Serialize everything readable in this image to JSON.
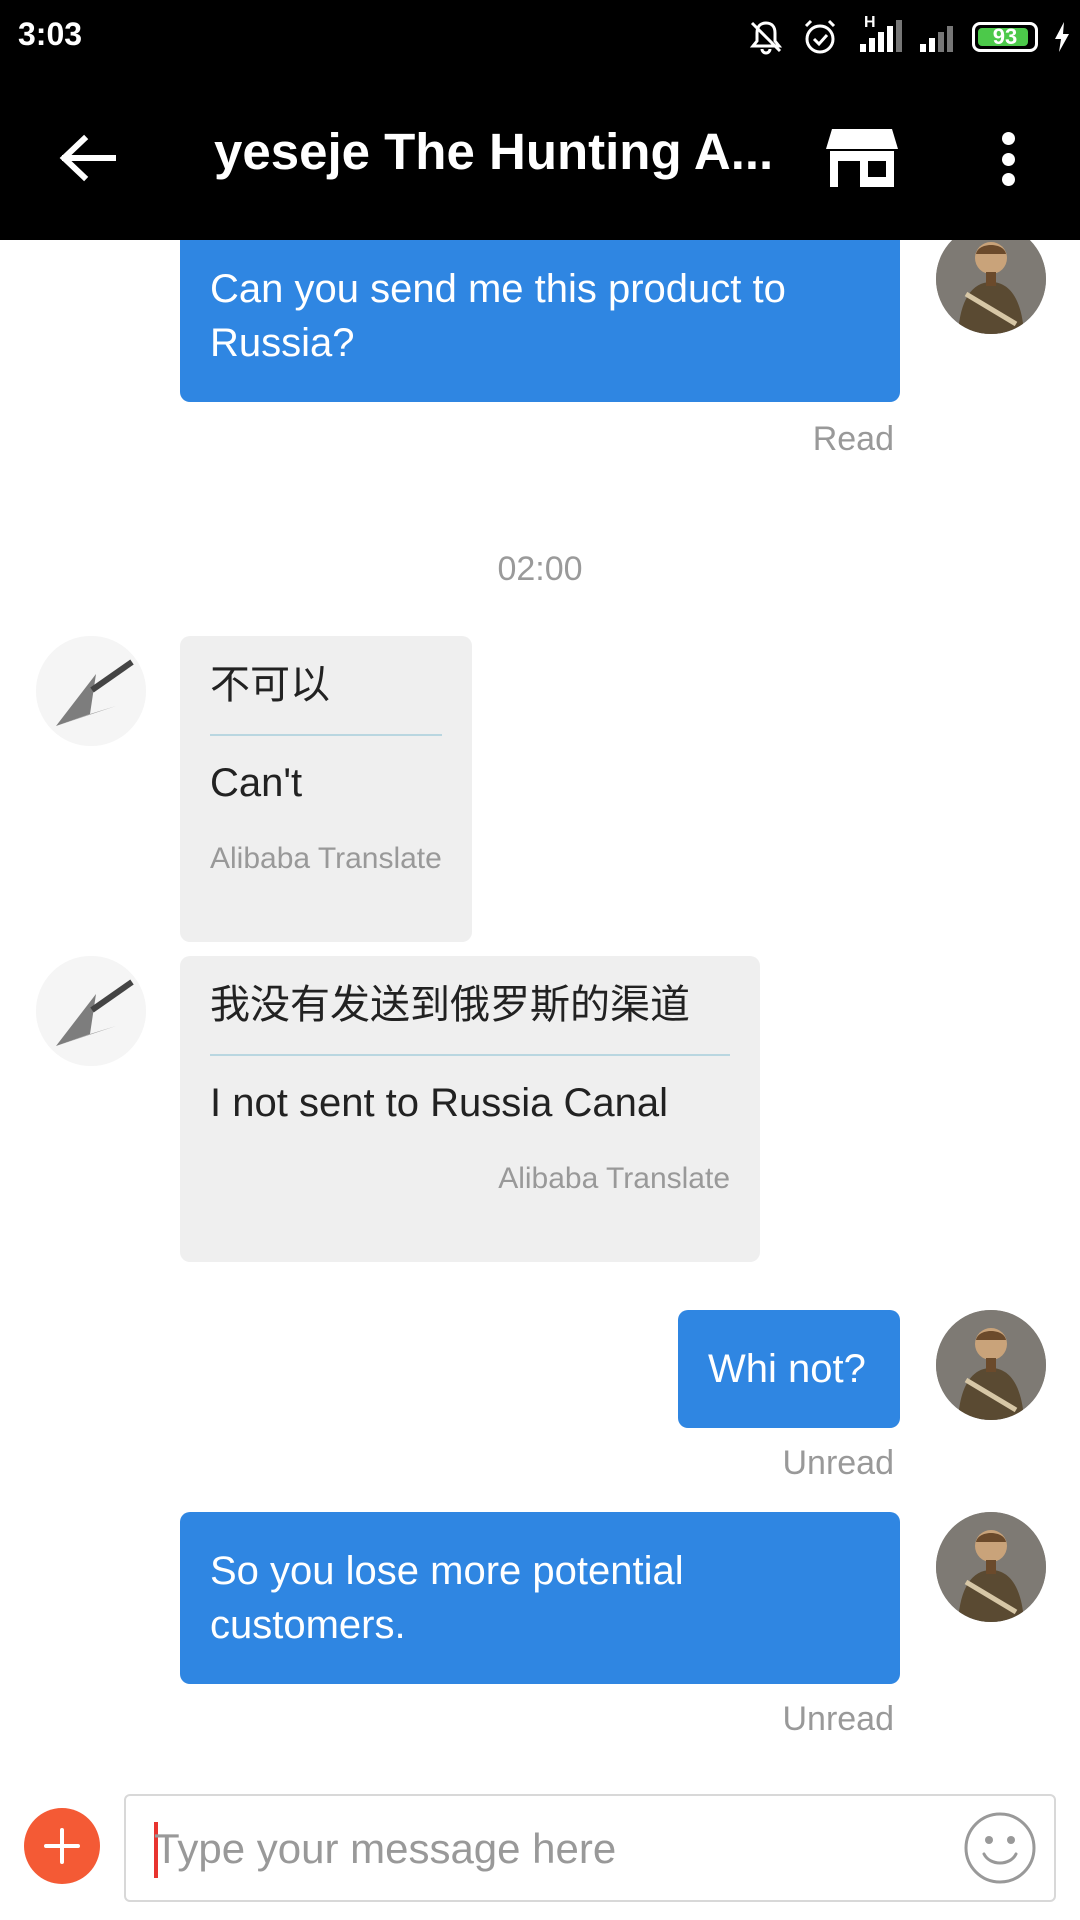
{
  "status_bar": {
    "time": "3:03",
    "network": "H",
    "battery": "93",
    "battery_level": 0.93
  },
  "toolbar": {
    "title": "yeseje The Hunting A...",
    "icons": [
      "arrow-left-icon",
      "store-icon",
      "more-vertical-icon"
    ]
  },
  "messages": {
    "m1": {
      "text": "Can you send me this product to Russia?",
      "status": "Read"
    },
    "time_sep": "02:00",
    "m2": {
      "original": "不可以",
      "translation": "Can't",
      "credit": "Alibaba Translate"
    },
    "m3": {
      "original": "我没有发送到俄罗斯的渠道",
      "translation": "I not sent to Russia Canal",
      "credit": "Alibaba Translate"
    },
    "m4": {
      "text": "Whi not?",
      "status": "Unread"
    },
    "m5": {
      "text": "So you lose more potential customers.",
      "status": "Unread"
    }
  },
  "input": {
    "placeholder": "Type your message here",
    "value": ""
  },
  "colors": {
    "outgoing_bubble": "#2f86e2",
    "incoming_bubble": "#efefef",
    "accent_add": "#f45a35",
    "battery": "#4cc94a"
  }
}
